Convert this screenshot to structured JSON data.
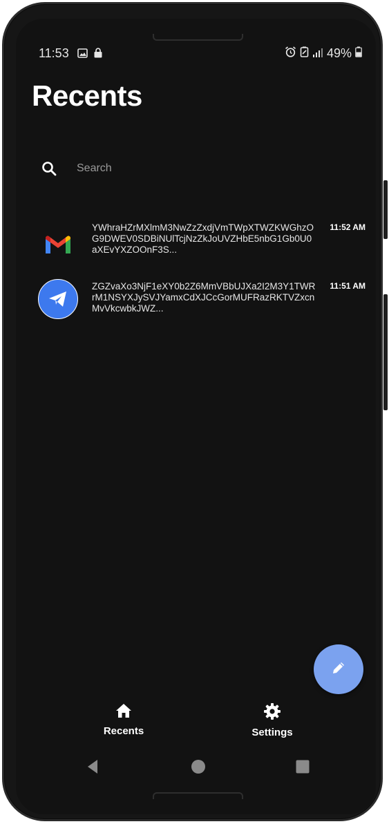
{
  "status_bar": {
    "time": "11:53",
    "battery": "49%"
  },
  "header": {
    "title": "Recents"
  },
  "search": {
    "placeholder": "Search"
  },
  "conversations": [
    {
      "app": "gmail",
      "icon": "gmail-icon",
      "preview": "YWhraHZrMXlmM3NwZzZxdjVmTWpXTWZKWGhzOG9DWEV0SDBiNUlTcjNzZkJoUVZHbE5nbG1Gb0U0\naXEvYXZOOnF3S...",
      "time": "11:52 AM"
    },
    {
      "app": "telegram",
      "icon": "telegram-icon",
      "preview": "ZGZvaXo3NjF1eXY0b2Z6MmVBbUJXa2I2M3Y1TWRrM1NSYXJySVJYamxCdXJCcGorMUFRazRKTVZxcnMvVkcwbkJWZ...",
      "time": "11:51 AM"
    }
  ],
  "fab": {
    "icon": "pencil-icon"
  },
  "bottom_nav": {
    "items": [
      {
        "label": "Recents",
        "icon": "home-icon"
      },
      {
        "label": "Settings",
        "icon": "gear-icon"
      }
    ]
  },
  "system_nav": {
    "buttons": [
      "back-icon",
      "home-circle-icon",
      "recents-square-icon"
    ]
  },
  "colors": {
    "background": "#121212",
    "fab": "#7ba2ef",
    "telegram_blue": "#3d79ee"
  }
}
